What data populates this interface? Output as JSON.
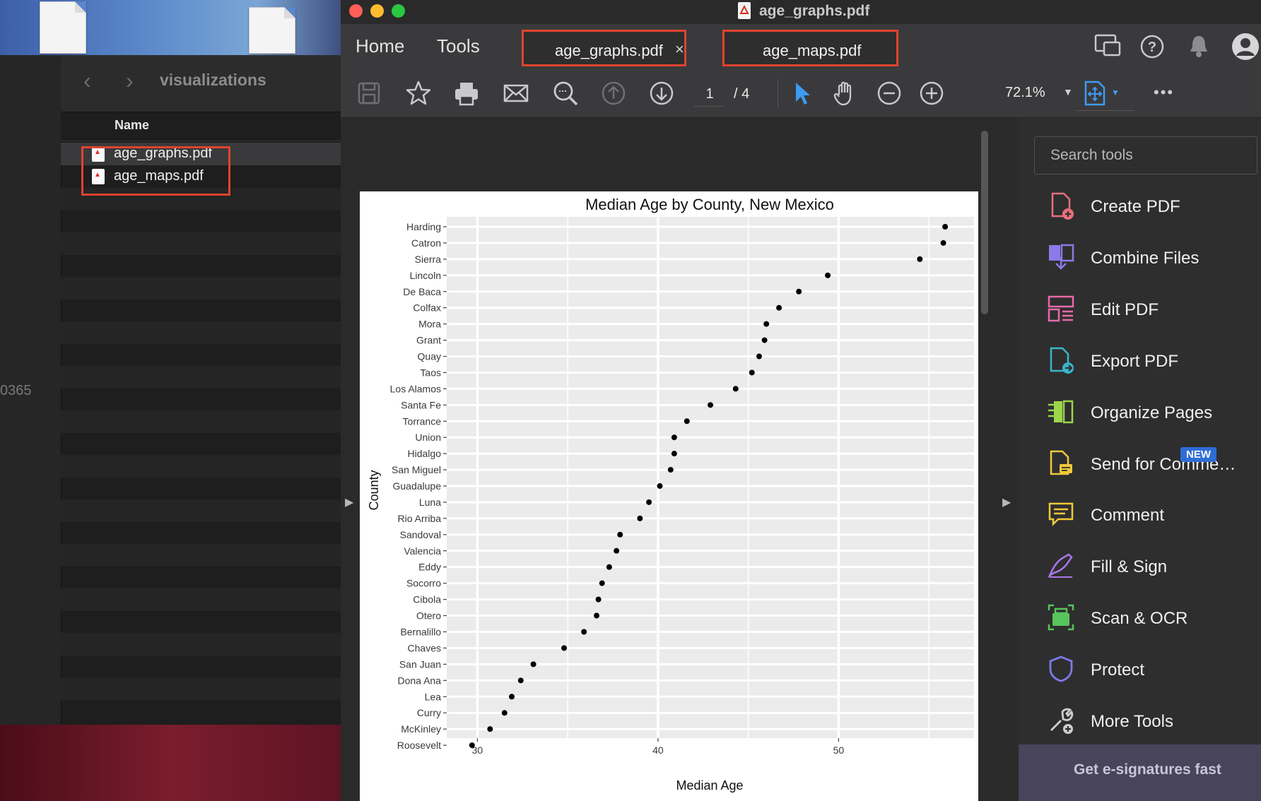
{
  "finder": {
    "folder": "visualizations",
    "column_name": "Name",
    "files": [
      "age_graphs.pdf",
      "age_maps.pdf"
    ],
    "cutoff_text": "0365"
  },
  "window": {
    "title": "age_graphs.pdf"
  },
  "tabs": {
    "home": "Home",
    "tools": "Tools",
    "doc1": "age_graphs.pdf",
    "doc2": "age_maps.pdf",
    "close": "×"
  },
  "toolbar": {
    "page_current": "1",
    "page_total": "/ 4",
    "zoom": "72.1%",
    "more": "•••"
  },
  "right_panel": {
    "search_placeholder": "Search tools",
    "tools": [
      {
        "label": "Create PDF",
        "icon": "create-pdf-icon",
        "color": "#e8707a"
      },
      {
        "label": "Combine Files",
        "icon": "combine-files-icon",
        "color": "#8c7ae6"
      },
      {
        "label": "Edit PDF",
        "icon": "edit-pdf-icon",
        "color": "#e86aa8"
      },
      {
        "label": "Export PDF",
        "icon": "export-pdf-icon",
        "color": "#39b6c9"
      },
      {
        "label": "Organize Pages",
        "icon": "organize-pages-icon",
        "color": "#9bd64b"
      },
      {
        "label": "Send for Comme…",
        "icon": "send-for-comment-icon",
        "color": "#f0c93a"
      },
      {
        "label": "Comment",
        "icon": "comment-icon",
        "color": "#f0c93a"
      },
      {
        "label": "Fill & Sign",
        "icon": "fill-sign-icon",
        "color": "#a978e6"
      },
      {
        "label": "Scan & OCR",
        "icon": "scan-ocr-icon",
        "color": "#58c45c"
      },
      {
        "label": "Protect",
        "icon": "protect-icon",
        "color": "#7d7ae8"
      },
      {
        "label": "More Tools",
        "icon": "more-tools-icon",
        "color": "#cfcfd1"
      }
    ],
    "new_badge": "NEW",
    "promo": "Get e-signatures fast"
  },
  "chart_data": {
    "type": "scatter",
    "title": "Median Age by County, New Mexico",
    "xlabel": "Median Age",
    "ylabel": "County",
    "xlim": [
      28.3,
      57.5
    ],
    "xticks": [
      30,
      40,
      50
    ],
    "grid": true,
    "categories": [
      "Harding",
      "Catron",
      "Sierra",
      "Lincoln",
      "De Baca",
      "Colfax",
      "Mora",
      "Grant",
      "Quay",
      "Taos",
      "Los Alamos",
      "Santa Fe",
      "Torrance",
      "Union",
      "Hidalgo",
      "San Miguel",
      "Guadalupe",
      "Luna",
      "Rio Arriba",
      "Sandoval",
      "Valencia",
      "Eddy",
      "Socorro",
      "Cibola",
      "Otero",
      "Bernalillo",
      "Chaves",
      "San Juan",
      "Dona Ana",
      "Lea",
      "Curry",
      "McKinley",
      "Roosevelt"
    ],
    "values": [
      55.9,
      55.8,
      54.5,
      49.4,
      47.8,
      46.7,
      46.0,
      45.9,
      45.6,
      45.2,
      44.3,
      42.9,
      41.6,
      40.9,
      40.9,
      40.7,
      40.1,
      39.5,
      39.0,
      37.9,
      37.7,
      37.3,
      36.9,
      36.7,
      36.6,
      35.9,
      34.8,
      33.1,
      32.4,
      31.9,
      31.5,
      30.7,
      29.7
    ]
  }
}
